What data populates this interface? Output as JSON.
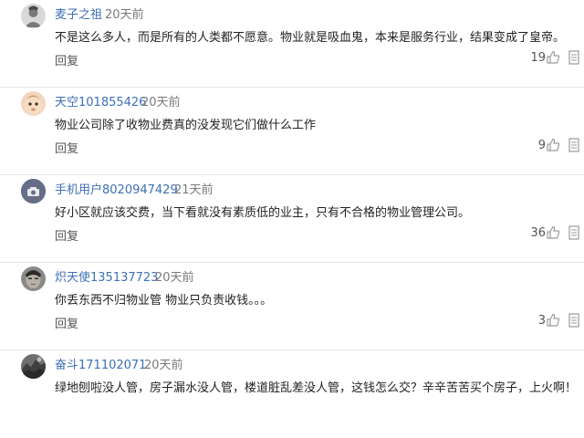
{
  "reply_label": "回复",
  "comments": [
    {
      "username": "麦子之祖",
      "time": "20天前",
      "text": "不是这么多人，而是所有的人类都不愿意。物业就是吸血鬼，本来是服务行业，结果变成了皇帝。",
      "likes": "19",
      "avatar_icon": "user-gray-avatar-icon"
    },
    {
      "username": "天空101855426",
      "time": "20天前",
      "text": "物业公司除了收物业费真的没发现它们做什么工作",
      "likes": "9",
      "avatar_icon": "baby-face-avatar-icon"
    },
    {
      "username": "手机用户8020947429",
      "time": "21天前",
      "text": "好小区就应该交费，当下看就没有素质低的业主，只有不合格的物业管理公司。",
      "likes": "36",
      "avatar_icon": "default-avatar-icon"
    },
    {
      "username": "炽天使135137723",
      "time": "20天前",
      "text": "你丢东西不归物业管 物业只负责收钱。。。",
      "likes": "3",
      "avatar_icon": "face-photo-avatar-icon"
    },
    {
      "username": "奋斗171102071",
      "time": "20天前",
      "text": "绿地刨啦没人管，房子漏水没人管，楼道脏乱差没人管，这钱怎么交？辛辛苦苦买个房子，上火啊！",
      "likes": "",
      "avatar_icon": "rock-photo-avatar-icon"
    }
  ]
}
